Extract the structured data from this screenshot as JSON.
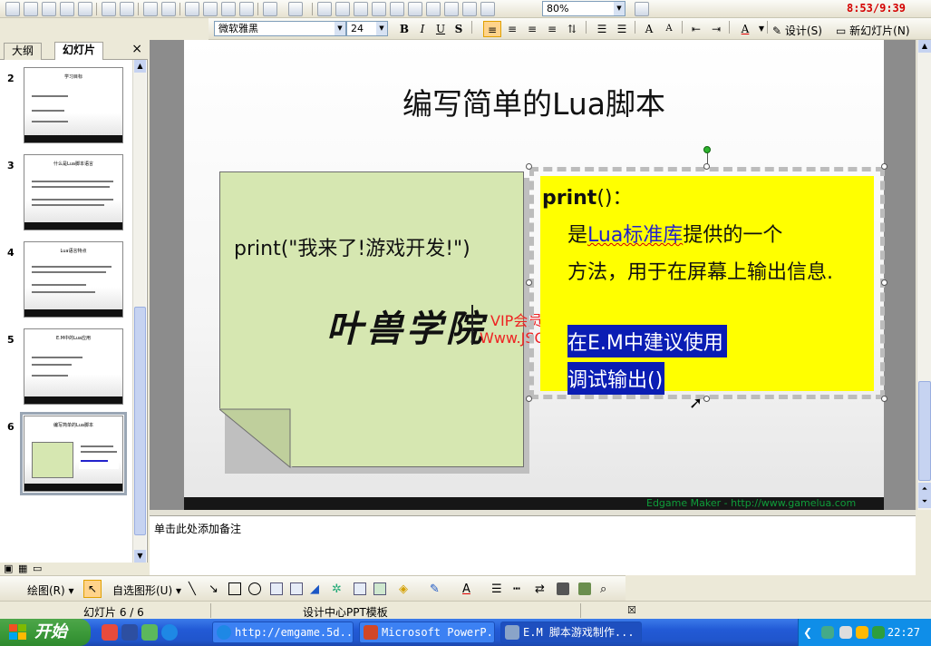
{
  "toolbar": {
    "zoom": "80%",
    "clock": "8:53/9:39",
    "font_name": "微软雅黑",
    "font_size": "24",
    "design_label": "设计(S)",
    "new_slide_label": "新幻灯片(N)"
  },
  "panel": {
    "tabs": [
      "大纲",
      "幻灯片"
    ],
    "close": "×",
    "slides": [
      {
        "num": "2",
        "title": "学习目标"
      },
      {
        "num": "3",
        "title": "什么是Lua脚本语言"
      },
      {
        "num": "4",
        "title": "Lua语言特点"
      },
      {
        "num": "5",
        "title": "E.M中的Lua应用"
      },
      {
        "num": "6",
        "title": "编写简单的Lua脚本"
      }
    ]
  },
  "slide": {
    "title": "编写简单的Lua脚本",
    "note_code": "print(\"我来了!游戏开发!\")",
    "brand": "叶兽学院",
    "watermark_line1": "VIP会员论坛",
    "watermark_line2": "Www.JSOJC.com",
    "footer": "Edgame Maker - http://www.gamelua.com",
    "textbox": {
      "line1_bold": "print",
      "line1_rest": "()：",
      "line2_a": "是",
      "line2_b": "Lua标准库",
      "line2_c": "提供的一个",
      "line3": "方法，用于在屏幕上输出信息.",
      "line4": "在E.M中建议使用",
      "line5": "调试输出()"
    }
  },
  "notes": {
    "placeholder": "单击此处添加备注"
  },
  "drawbar": {
    "draw_label": "绘图(R)",
    "autoshape_label": "自选图形(U)"
  },
  "status": {
    "slide_pos": "幻灯片 6 / 6",
    "template": "设计中心PPT模板"
  },
  "taskbar": {
    "start": "开始",
    "items": [
      "http://emgame.5d...",
      "Microsoft PowerP...",
      "E.M 脚本游戏制作..."
    ],
    "time": "22:27"
  },
  "colors": {
    "textbox_bg": "#ffff00",
    "highlight": "#0a1db4",
    "note_bg": "#d6e7b1",
    "watermark": "#ee2222"
  }
}
